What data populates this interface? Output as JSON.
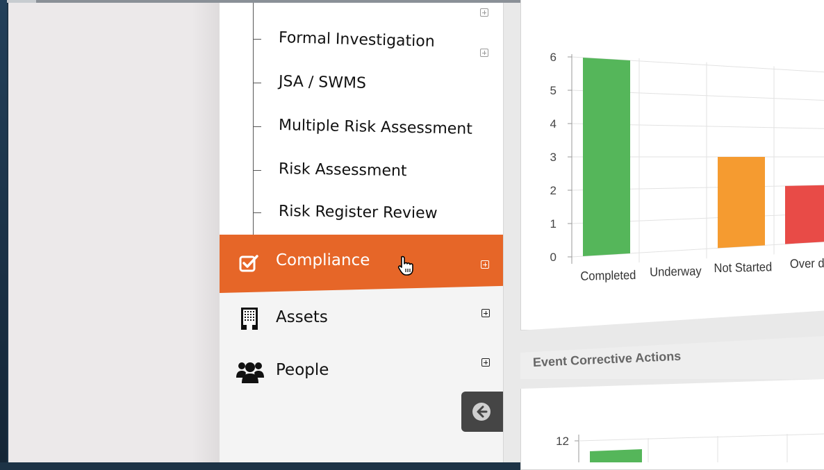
{
  "sidebar": {
    "subitems": [
      {
        "label": "Formal Investigation",
        "has_expand": true
      },
      {
        "label": "JSA / SWMS",
        "has_expand": false
      },
      {
        "label": "Multiple Risk Assessment",
        "has_expand": false
      },
      {
        "label": "Risk Assessment",
        "has_expand": false
      },
      {
        "label": "Risk Register Review",
        "has_expand": false
      }
    ],
    "nav": [
      {
        "label": "Compliance",
        "icon": "checkbox-icon",
        "active": true
      },
      {
        "label": "Assets",
        "icon": "building-icon",
        "active": false
      },
      {
        "label": "People",
        "icon": "people-icon",
        "active": false
      }
    ],
    "collapse_icon": "arrow-left-circle-icon"
  },
  "colors": {
    "accent": "#e66628",
    "completed": "#55b65a",
    "not_started": "#f59b30",
    "overdue": "#e84b47"
  },
  "event_corrective_actions": {
    "title": "Event Corrective Actions"
  },
  "chart_data": [
    {
      "type": "bar",
      "categories": [
        "Completed",
        "Underway",
        "Not Started",
        "Over du"
      ],
      "values": [
        6,
        0,
        3,
        2
      ],
      "ylim": [
        0,
        6
      ],
      "yticks": [
        "0",
        "1",
        "2",
        "3",
        "4",
        "5",
        "6"
      ],
      "grid": true,
      "colors": [
        "#55b65a",
        "#55b65a",
        "#f59b30",
        "#e84b47"
      ]
    },
    {
      "type": "bar",
      "categories": [],
      "values": [],
      "yticks": [
        "12"
      ],
      "grid": true
    }
  ]
}
